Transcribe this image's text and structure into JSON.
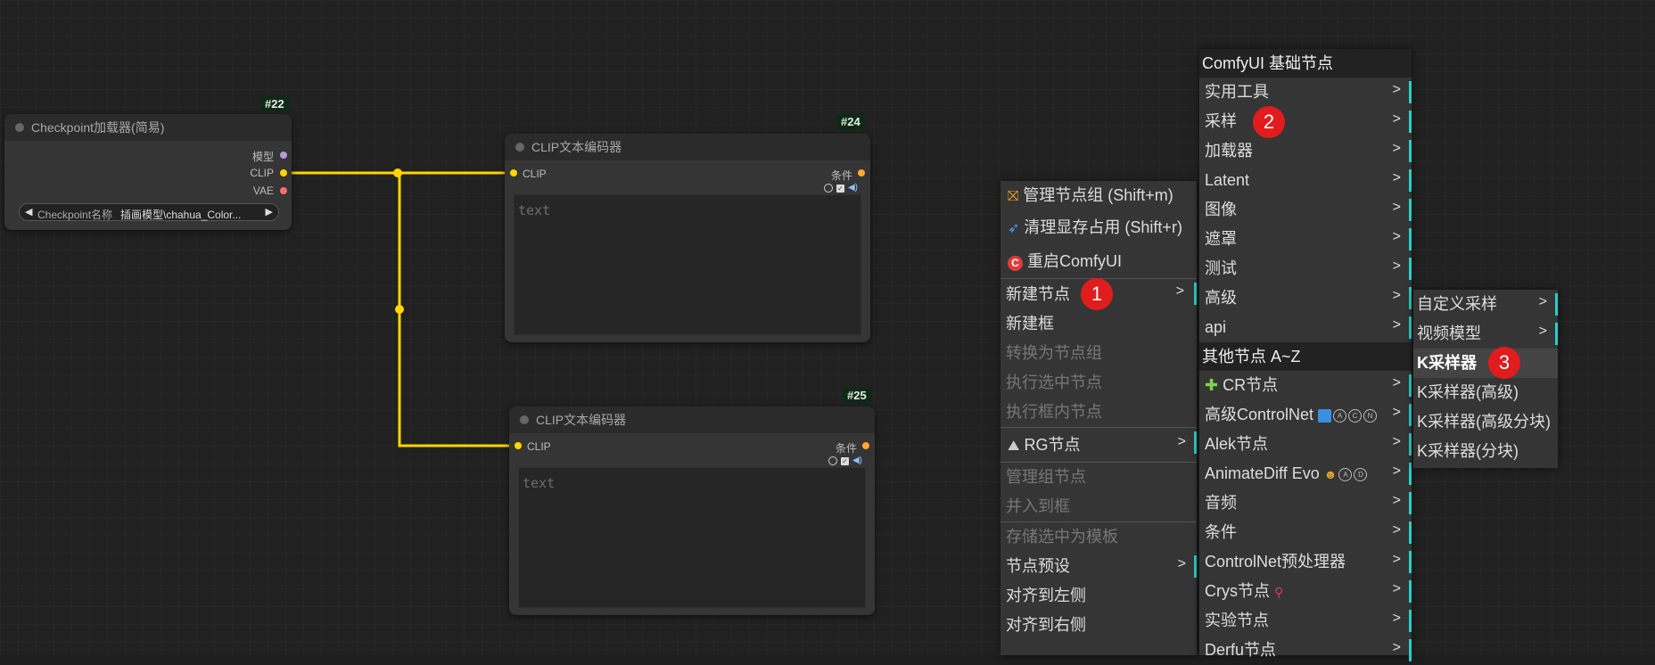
{
  "nodes": {
    "checkpoint": {
      "id": "#22",
      "title": "Checkpoint加载器(简易)",
      "outputs": [
        "模型",
        "CLIP",
        "VAE"
      ],
      "widget_label": "Checkpoint名称",
      "widget_value": "插画模型\\chahua_Color..."
    },
    "clip1": {
      "id": "#24",
      "title": "CLIP文本编码器",
      "input": "CLIP",
      "output": "条件",
      "placeholder": "text"
    },
    "clip2": {
      "id": "#25",
      "title": "CLIP文本编码器",
      "input": "CLIP",
      "output": "条件",
      "placeholder": "text"
    }
  },
  "context_menu": {
    "items": [
      {
        "label": "管理节点组 (Shift+m)",
        "icon": "node-group-icon"
      },
      {
        "label": "清理显存占用 (Shift+r)",
        "icon": "rocket-icon"
      },
      {
        "label": "重启ComfyUI",
        "icon": "restart-icon"
      },
      {
        "label": "新建节点",
        "badge": "1"
      },
      {
        "label": "新建框"
      },
      {
        "label": "转换为节点组"
      },
      {
        "label": "执行选中节点"
      },
      {
        "label": "执行框内节点"
      },
      {
        "label": "RG节点",
        "icon": "rg-icon"
      },
      {
        "label": "管理组节点"
      },
      {
        "label": "并入到框"
      },
      {
        "label": "存储选中为模板"
      },
      {
        "label": "节点预设"
      },
      {
        "label": "对齐到左侧"
      },
      {
        "label": "对齐到右侧"
      }
    ],
    "arrow": ">"
  },
  "submenu": {
    "header": "ComfyUI 基础节点",
    "items": [
      "实用工具",
      "采样",
      "加载器",
      "Latent",
      "图像",
      "遮罩",
      "测试",
      "高级",
      "api"
    ],
    "badge": "2",
    "header2": "其他节点 A~Z",
    "items2": [
      "CR节点",
      "高级ControlNet",
      "Alek节点",
      "AnimateDiff Evo",
      "音频",
      "条件",
      "ControlNet预处理器",
      "Crys节点",
      "实验节点",
      "Derfu节点"
    ],
    "acn": [
      "A",
      "C",
      "N"
    ],
    "ad": [
      "A",
      "D"
    ]
  },
  "sampler_menu": {
    "items": [
      "自定义采样",
      "视频模型",
      "K采样器",
      "K采样器(高级)",
      "K采样器(高级分块)",
      "K采样器(分块)"
    ],
    "badge": "3"
  },
  "colors": {
    "clip_wire": "#ffd500",
    "accent_bar": "#27d0c8",
    "badge": "#e11c1c"
  }
}
